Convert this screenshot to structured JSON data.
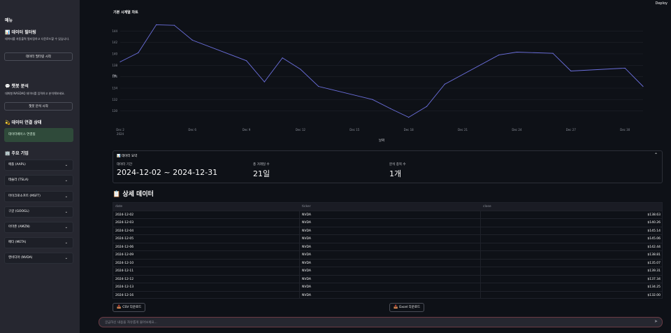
{
  "sidebar": {
    "menu_title": "메뉴",
    "filter_section": {
      "icon": "bar-chart-icon",
      "title": "📊 데이터 필터링",
      "desc": "데이터를 자동출력 필터링하고 다운로드할 수 있습니다.",
      "button": "데이터 필터링 시작"
    },
    "chat_section": {
      "icon": "speech-bubble-icon",
      "title": "💬 챗봇 분석",
      "desc": "대화형 NASDAQ 데이터를 입력하고 분석해보세요.",
      "button": "챗봇 분석 시작"
    },
    "status_section": {
      "icon": "satellite-icon",
      "title": "💫 데이터 연결 상태",
      "status": "데이터베이스 연결됨"
    },
    "companies_section": {
      "icon": "building-icon",
      "title": "🏢 주요 기업",
      "items": [
        "애플 (AAPL)",
        "테슬라 (TSLA)",
        "마이크로소프트 (MSFT)",
        "구글 (GOOGL)",
        "아마존 (AMZN)",
        "메타 (META)",
        "엔비디아 (NVDA)"
      ]
    }
  },
  "header": {
    "deploy": "Deploy"
  },
  "chart_title": "기본 시계열 차트",
  "chart_data": {
    "type": "line",
    "title": "기본 시계열 차트",
    "xlabel": "날짜",
    "ylabel": "PA",
    "x": [
      "2024-12-02",
      "2024-12-03",
      "2024-12-04",
      "2024-12-05",
      "2024-12-06",
      "2024-12-09",
      "2024-12-10",
      "2024-12-11",
      "2024-12-12",
      "2024-12-13",
      "2024-12-16",
      "2024-12-17",
      "2024-12-18",
      "2024-12-19",
      "2024-12-20",
      "2024-12-23",
      "2024-12-24",
      "2024-12-26",
      "2024-12-27",
      "2024-12-30",
      "2024-12-31"
    ],
    "series": [
      {
        "values": [
          138.6,
          140.2,
          145.1,
          145.0,
          142.4,
          138.8,
          135.1,
          139.3,
          137.3,
          134.3,
          132.0,
          130.4,
          128.9,
          130.8,
          134.7,
          139.8,
          140.3,
          140.1,
          137.0,
          137.5,
          134.3
        ]
      }
    ],
    "x_tick_labels": [
      "Dec 2\n2024",
      "Dec 6",
      "Dec 9",
      "Dec 12",
      "Dec 15",
      "Dec 18",
      "Dec 21",
      "Dec 24",
      "Dec 27",
      "Dec 30"
    ],
    "y_tick_labels": [
      "130",
      "132",
      "134",
      "136",
      "138",
      "140",
      "142",
      "144"
    ],
    "ylim": [
      128,
      146
    ],
    "line_color": "#6b6fdc",
    "grid": true
  },
  "metrics": {
    "header": "📊 데이터 요약",
    "items": [
      {
        "label": "데이터 기간",
        "value": "2024-12-02 ~ 2024-12-31"
      },
      {
        "label": "총 거래일 수",
        "value": "21일"
      },
      {
        "label": "분석 종목 수",
        "value": "1개"
      }
    ]
  },
  "detail_title": "📋 상세 데이터",
  "table": {
    "columns": [
      "date",
      "ticker",
      "close"
    ],
    "rows": [
      [
        "2024-12-02",
        "NVDA",
        "$138.63"
      ],
      [
        "2024-12-03",
        "NVDA",
        "$140.26"
      ],
      [
        "2024-12-04",
        "NVDA",
        "$145.14"
      ],
      [
        "2024-12-05",
        "NVDA",
        "$145.06"
      ],
      [
        "2024-12-06",
        "NVDA",
        "$142.44"
      ],
      [
        "2024-12-09",
        "NVDA",
        "$138.81"
      ],
      [
        "2024-12-10",
        "NVDA",
        "$135.07"
      ],
      [
        "2024-12-11",
        "NVDA",
        "$139.31"
      ],
      [
        "2024-12-12",
        "NVDA",
        "$137.34"
      ],
      [
        "2024-12-13",
        "NVDA",
        "$134.25"
      ],
      [
        "2024-12-16",
        "NVDA",
        "$132.00"
      ]
    ]
  },
  "downloads": {
    "csv": "CSV 다운로드",
    "excel": "Excel 다운로드"
  },
  "chat": {
    "placeholder": "궁금하신 내용을 자유롭게 물어보세요..."
  }
}
